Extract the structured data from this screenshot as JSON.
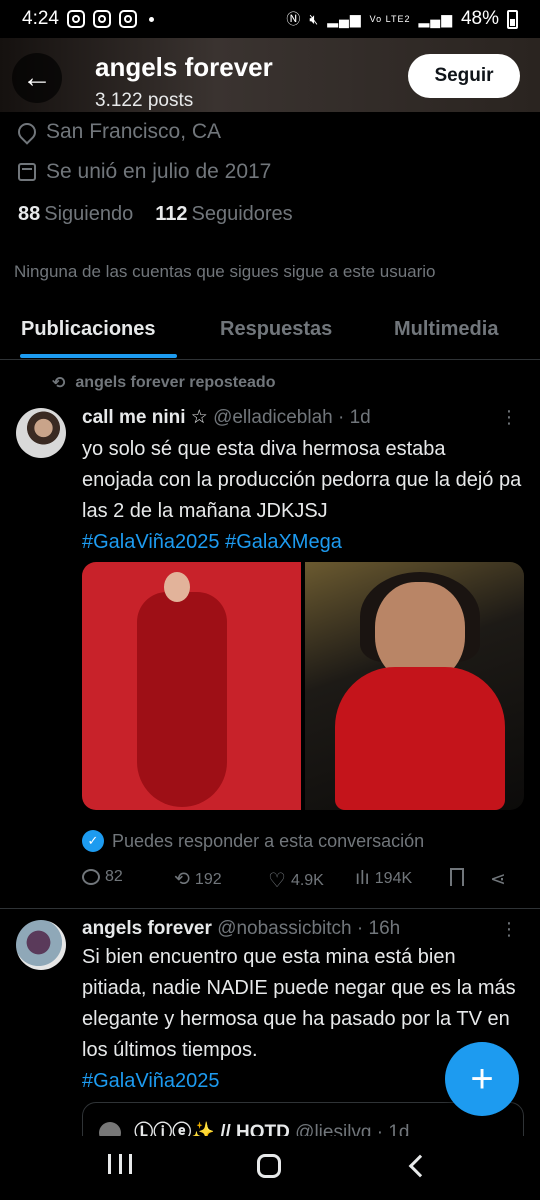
{
  "status_bar": {
    "time": "4:24",
    "battery": "48%",
    "network": "Vo LTE2"
  },
  "header": {
    "title": "angels forever",
    "post_count": "3.122 posts",
    "follow_label": "Seguir",
    "back_icon": "arrow-left-icon"
  },
  "profile": {
    "location": "San Francisco, CA",
    "joined": "Se unió en julio de 2017",
    "following_count": "88",
    "following_label": "Siguiendo",
    "followers_count": "112",
    "followers_label": "Seguidores",
    "mutual_note": "Ninguna de las cuentas que sigues sigue a este usuario"
  },
  "tabs": [
    {
      "label": "Publicaciones",
      "active": true
    },
    {
      "label": "Respuestas",
      "active": false
    },
    {
      "label": "Multimedia",
      "active": false
    }
  ],
  "tweet1": {
    "repost_label": "angels forever reposteado",
    "name": "call me nini ☆",
    "handle": "@elladiceblah",
    "time": "· 1d",
    "text": "yo solo sé que esta diva hermosa estaba enojada con la producción pedorra que la dejó pa las 2 de la mañana JDKJSJ",
    "hashtags": "#GalaViña2025 #GalaXMega",
    "reply_note": "Puedes responder a esta conversación",
    "replies": "82",
    "reposts": "192",
    "likes": "4.9K",
    "views": "194K"
  },
  "tweet2": {
    "name": "angels forever",
    "handle": "@nobassicbitch",
    "time": "· 16h",
    "text": "Si bien encuentro que esta mina está bien pitiada, nadie NADIE puede negar que es la más elegante y hermosa que ha pasado por la TV en los últimos tiempos.",
    "hashtags": "#GalaViña2025",
    "quote_name": "Ⓛⓘⓔ✨ // HOTD",
    "quote_handle": "@liesilvg · 1d"
  },
  "fab_label": "+",
  "colors": {
    "accent": "#1d9bf0",
    "background": "#000000",
    "muted": "#71767b",
    "text": "#e7e9ea"
  }
}
